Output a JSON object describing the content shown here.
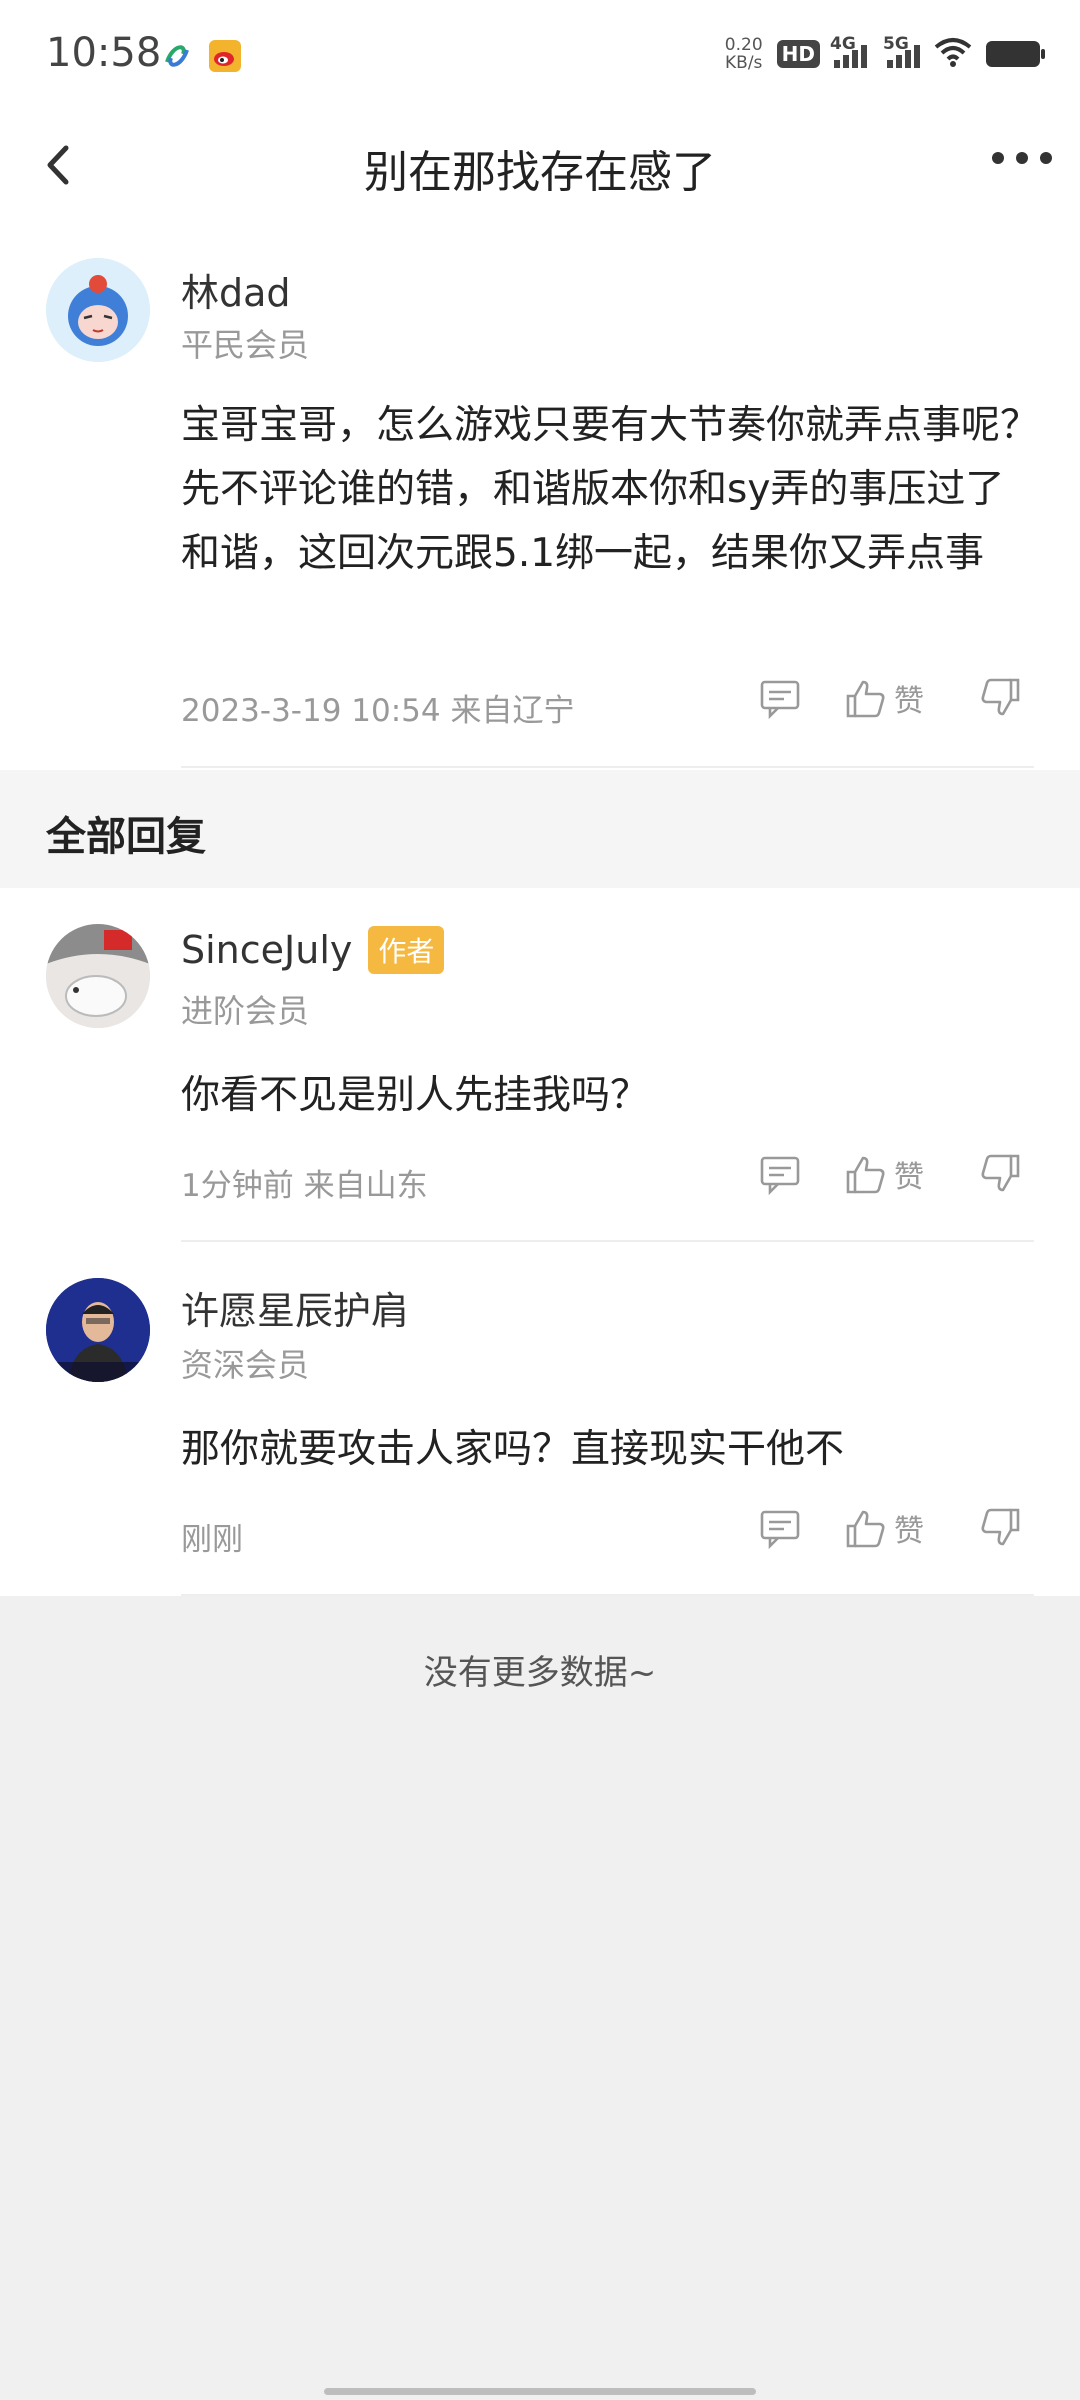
{
  "status_bar": {
    "time": "10:58",
    "net_speed_value": "0.20",
    "net_speed_unit": "KB/s",
    "hd_label": "HD",
    "sim_label_1": "4G",
    "sim_label_2": "5G",
    "icons": [
      "china-mobile-icon",
      "weibo-icon",
      "wifi-icon",
      "battery-icon"
    ]
  },
  "nav": {
    "title": "别在那找存在感了"
  },
  "main_comment": {
    "username": "林dad",
    "level": "平民会员",
    "content": "宝哥宝哥，怎么游戏只要有大节奏你就弄点事呢？先不评论谁的错，和谐版本你和sy弄的事压过了和谐，这回次元跟5.1绑一起，结果你又弄点事",
    "meta": "2023-3-19 10:54  来自辽宁",
    "like_label": "赞"
  },
  "section": {
    "title": "全部回复"
  },
  "replies": [
    {
      "username": "SinceJuly",
      "badge": "作者",
      "level": "进阶会员",
      "content": "你看不见是别人先挂我吗？",
      "meta": "1分钟前 来自山东",
      "like_label": "赞"
    },
    {
      "username": "许愿星辰护肩",
      "level": "资深会员",
      "content": "那你就要攻击人家吗？直接现实干他不",
      "meta": "刚刚",
      "like_label": "赞"
    }
  ],
  "footer": {
    "no_more": "没有更多数据~"
  },
  "colors": {
    "badge": "#f5b942",
    "text_main": "#222222",
    "text_muted": "#999999",
    "page_bg": "#f0f0f0"
  }
}
